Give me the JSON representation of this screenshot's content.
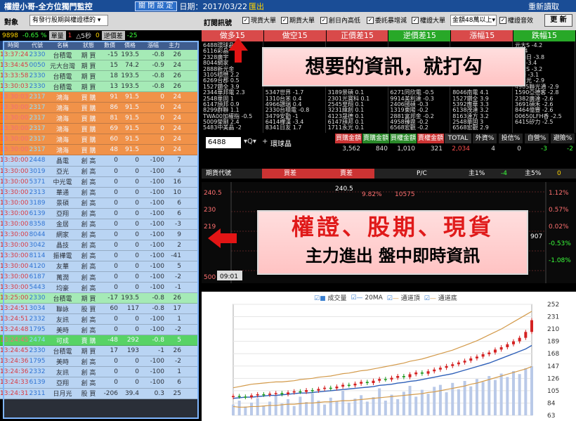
{
  "titlebar": {
    "title": "權證小哥-全方位獨門監控",
    "close_settings": "關 閉 設 定",
    "date_label": "日期：2017/03/22",
    "export": "匯出",
    "reload": "重新讀取"
  },
  "toolbar": {
    "target_label": "對象",
    "target_value": "有發行股期與權證標的",
    "subscribe_label": "訂閱訊號",
    "checkboxes": [
      "現貨大單",
      "期貨大單",
      "創日內高低",
      "委託暴增減",
      "權證大單",
      "權證音效"
    ],
    "amount_value": "金額48萬以上",
    "update": "更 新"
  },
  "stats": {
    "index": "9898",
    "pct": "-0.65 %",
    "mode": "單量",
    "qty": "1",
    "interval": "△5秒",
    "zero": "0",
    "inverse": "逆價差",
    "diff": "-25"
  },
  "columns": [
    "時間",
    "代號",
    "名稱",
    "狀態",
    "數價",
    "價格",
    "漲幅",
    "主力"
  ],
  "rows": [
    {
      "t": "13:37:24",
      "code": "2330",
      "name": "台積電",
      "st": "期 買",
      "q": "-15",
      "p": "193.5",
      "chg": "-0.8",
      "m": "26",
      "bg": "#9ef0a2"
    },
    {
      "t": "13:34:45",
      "code": "0050",
      "name": "元大台灣",
      "st": "期 買",
      "q": "15",
      "p": "74.2",
      "chg": "-0.9",
      "m": "24",
      "bg": "#9ef0a2"
    },
    {
      "t": "13:33:58",
      "code": "2330",
      "name": "台積電",
      "st": "期 買",
      "q": "18",
      "p": "193.5",
      "chg": "-0.8",
      "m": "26",
      "bg": "#9ef0a2"
    },
    {
      "t": "13:30:03",
      "code": "2330",
      "name": "台積電",
      "st": "期 買",
      "q": "13",
      "p": "193.5",
      "chg": "-0.8",
      "m": "26",
      "bg": "#9ef0a2"
    },
    {
      "t": "13:30:03",
      "code": "2317",
      "name": "鴻海",
      "st": "買 購",
      "q": "91",
      "p": "91.5",
      "chg": "0",
      "m": "24",
      "bg": "#ff7f17"
    },
    {
      "t": "13:30:00",
      "code": "2317",
      "name": "鴻海",
      "st": "買 購",
      "q": "86",
      "p": "91.5",
      "chg": "0",
      "m": "24",
      "bg": "#ff7f17"
    },
    {
      "t": "13:30:00",
      "code": "2317",
      "name": "鴻海",
      "st": "買 購",
      "q": "81",
      "p": "91.5",
      "chg": "0",
      "m": "24",
      "bg": "#ff7f17"
    },
    {
      "t": "13:30:00",
      "code": "2317",
      "name": "鴻海",
      "st": "買 購",
      "q": "69",
      "p": "91.5",
      "chg": "0",
      "m": "24",
      "bg": "#ff7f17"
    },
    {
      "t": "13:30:00",
      "code": "2317",
      "name": "鴻海",
      "st": "買 購",
      "q": "60",
      "p": "91.5",
      "chg": "0",
      "m": "24",
      "bg": "#ff7f17"
    },
    {
      "t": "13:30:00",
      "code": "2317",
      "name": "鴻海",
      "st": "買 購",
      "q": "48",
      "p": "91.5",
      "chg": "0",
      "m": "24",
      "bg": "#ff7f17"
    },
    {
      "t": "13:30:00",
      "code": "2448",
      "name": "晶電",
      "st": "創 高",
      "q": "0",
      "p": "0",
      "chg": "-100",
      "m": "7",
      "bg": "#b8d4f0"
    },
    {
      "t": "13:30:00",
      "code": "3019",
      "name": "亞光",
      "st": "創 高",
      "q": "0",
      "p": "0",
      "chg": "-100",
      "m": "4",
      "bg": "#b8d4f0"
    },
    {
      "t": "13:30:00",
      "code": "5371",
      "name": "中光電",
      "st": "創 高",
      "q": "0",
      "p": "0",
      "chg": "-100",
      "m": "16",
      "bg": "#b8d4f0"
    },
    {
      "t": "13:30:00",
      "code": "2313",
      "name": "華通",
      "st": "創 高",
      "q": "0",
      "p": "0",
      "chg": "-100",
      "m": "10",
      "bg": "#b8d4f0"
    },
    {
      "t": "13:30:00",
      "code": "3189",
      "name": "景碩",
      "st": "創 高",
      "q": "0",
      "p": "0",
      "chg": "-100",
      "m": "6",
      "bg": "#b8d4f0"
    },
    {
      "t": "13:30:00",
      "code": "6139",
      "name": "亞翔",
      "st": "創 高",
      "q": "0",
      "p": "0",
      "chg": "-100",
      "m": "6",
      "bg": "#b8d4f0"
    },
    {
      "t": "13:30:00",
      "code": "8358",
      "name": "金居",
      "st": "創 高",
      "q": "0",
      "p": "0",
      "chg": "-100",
      "m": "-3",
      "bg": "#b8d4f0"
    },
    {
      "t": "13:30:00",
      "code": "8044",
      "name": "網家",
      "st": "創 高",
      "q": "0",
      "p": "0",
      "chg": "-100",
      "m": "9",
      "bg": "#b8d4f0"
    },
    {
      "t": "13:30:00",
      "code": "3042",
      "name": "晶技",
      "st": "創 高",
      "q": "0",
      "p": "0",
      "chg": "-100",
      "m": "2",
      "bg": "#b8d4f0"
    },
    {
      "t": "13:30:00",
      "code": "8114",
      "name": "振樺電",
      "st": "創 高",
      "q": "0",
      "p": "0",
      "chg": "-100",
      "m": "-41",
      "bg": "#b8d4f0"
    },
    {
      "t": "13:30:00",
      "code": "4120",
      "name": "友華",
      "st": "創 高",
      "q": "0",
      "p": "0",
      "chg": "-100",
      "m": "5",
      "bg": "#b8d4f0"
    },
    {
      "t": "13:30:00",
      "code": "6187",
      "name": "萬潤",
      "st": "創 高",
      "q": "0",
      "p": "0",
      "chg": "-100",
      "m": "-2",
      "bg": "#b8d4f0"
    },
    {
      "t": "13:30:00",
      "code": "5443",
      "name": "均豪",
      "st": "創 高",
      "q": "0",
      "p": "0",
      "chg": "-100",
      "m": "-1",
      "bg": "#b8d4f0"
    },
    {
      "t": "13:25:00",
      "code": "2330",
      "name": "台積電",
      "st": "期 買",
      "q": "-17",
      "p": "193.5",
      "chg": "-0.8",
      "m": "26",
      "bg": "#9ef0a2"
    },
    {
      "t": "13:24:51",
      "code": "3034",
      "name": "聯詠",
      "st": "股 買",
      "q": "60",
      "p": "117",
      "chg": "-0.8",
      "m": "17",
      "bg": "#b8d4f0"
    },
    {
      "t": "13:24:51",
      "code": "2332",
      "name": "友訊",
      "st": "創 高",
      "q": "0",
      "p": "0",
      "chg": "-100",
      "m": "1",
      "bg": "#b8d4f0"
    },
    {
      "t": "13:24:48",
      "code": "1795",
      "name": "美時",
      "st": "創 高",
      "q": "0",
      "p": "0",
      "chg": "-100",
      "m": "-2",
      "bg": "#b8d4f0"
    },
    {
      "t": "13:24:45",
      "code": "2474",
      "name": "可成",
      "st": "賣 購",
      "q": "-48",
      "p": "292",
      "chg": "-0.8",
      "m": "5",
      "bg": "#3bd23b"
    },
    {
      "t": "13:24:45",
      "code": "2330",
      "name": "台積電",
      "st": "期 買",
      "q": "17",
      "p": "193",
      "chg": "-1",
      "m": "26",
      "bg": "#b8d4f0"
    },
    {
      "t": "13:24:36",
      "code": "1795",
      "name": "美時",
      "st": "創 高",
      "q": "0",
      "p": "0",
      "chg": "-100",
      "m": "-2",
      "bg": "#b8d4f0"
    },
    {
      "t": "13:24:36",
      "code": "2332",
      "name": "友訊",
      "st": "創 高",
      "q": "0",
      "p": "0",
      "chg": "-100",
      "m": "1",
      "bg": "#b8d4f0"
    },
    {
      "t": "13:24:33",
      "code": "6139",
      "name": "亞翔",
      "st": "創 高",
      "q": "0",
      "p": "0",
      "chg": "-100",
      "m": "6",
      "bg": "#b8d4f0"
    },
    {
      "t": "13:24:31",
      "code": "2311",
      "name": "日月光",
      "st": "股 買",
      "q": "-206",
      "p": "39.4",
      "chg": "0.3",
      "m": "25",
      "bg": "#b8d4f0"
    }
  ],
  "tabs": [
    {
      "label": "做多15",
      "bg": "#d94a4a"
    },
    {
      "label": "做空15",
      "bg": "#d94a4a"
    },
    {
      "label": "正價差15",
      "bg": "#d94a4a"
    },
    {
      "label": "逆價差15",
      "bg": "#28a828"
    },
    {
      "label": "漲幅15",
      "bg": "#d94a4a"
    },
    {
      "label": "跌幅15",
      "bg": "#28a828"
    }
  ],
  "quote_cols": [
    [
      "6488環球晶",
      "6116彩晶",
      "2328廣宇",
      "8044網家",
      "2888新光金",
      "3105穩懋 2.2",
      "6269台郡 0.5",
      "1527鑽全 3.9",
      "2344華邦電 2.3",
      "2548華固 1",
      "6147頎邦 0.9",
      "8299群聯 1.1",
      "TWA00加權指 -0.5",
      "5009榮剛 2.4",
      "5483中美晶 -2"
    ],
    [
      "",
      "",
      "",
      "",
      "",
      "",
      "",
      "",
      "5347世界 -1.7",
      "1310台苯 0.4",
      "4966譜瑞 0.4",
      "2330台積電 -0.8",
      "3479安勤 -1",
      "6414樺漢 -3.4",
      "8341日友 1.7"
    ],
    [
      "",
      "",
      "",
      "",
      "",
      "",
      "",
      "",
      "3189景碩 0.1",
      "2301光寶科 0.1",
      "2545皇翔 0.1",
      "3231緯創 0.1",
      "4123晟德 0.1",
      "6147頎邦 0.1",
      "1711永光 0.1"
    ],
    [
      "",
      "",
      "",
      "",
      "",
      "",
      "",
      "",
      "6271同欣電 -0.5",
      "9914美利達 -0.3",
      "2406國碩 -0.3",
      "1319東陽 -0.2",
      "2881富邦金 -0.2",
      "4958臻鼎 -0.2",
      "6568宏觀 -0.2"
    ],
    [
      "",
      "",
      "",
      "",
      "",
      "",
      "",
      "",
      "8046南電 4.1",
      "1527鑽全 3.9",
      "5392應華 3.3",
      "6138茂達 3.2",
      "8163達方 3.2",
      "2548華固 3",
      "6568宏觀 2.9"
    ],
    [
      "元大S -4.2",
      "購 -4",
      "國泰日 -3.8",
      "元S -3.4",
      "元大S -3.2",
      "志精 -3.1",
      "群日光 -2.9",
      "4905聯光通 -2.9",
      "1590亞德客 -2.8",
      "2382廣達 -2.6",
      "3691碩禾 -2.6",
      "8464億豐 -2.6",
      "00650LFH香 -2.5",
      "6415矽力 -2.5",
      ""
    ]
  ],
  "midbar": {
    "symbol": "6488",
    "search": "▾Q▾",
    "plus": "+",
    "name": "環球晶",
    "headers": [
      "買購金額",
      "賣購金額",
      "買權金額",
      "賣權金額",
      "TOTAL",
      "外資%",
      "投信%",
      "自營%",
      "避險%"
    ],
    "values": [
      "3,562",
      "840",
      "1,010",
      "321",
      "2,034",
      "4",
      "0",
      "-3",
      "-2"
    ]
  },
  "futures": {
    "label": "期貨代號",
    "buy": "買差",
    "sell": "賣差",
    "pc": "P/C",
    "main1": "主1%",
    "main5": "主5%",
    "n1": "-4",
    "n5": "0"
  },
  "minichart": {
    "left_ticks": [
      "240.5",
      "230",
      "219",
      "",
      "",
      "500"
    ],
    "top_price": "240.5",
    "top_pct": "9.82%",
    "top_num": "10575",
    "right_ticks": [
      "1.12%",
      "0.57%",
      "0.02%",
      "-0.53%",
      "-1.08%"
    ],
    "mid_num": "907",
    "time": "09:01"
  },
  "chart_data": {
    "type": "line",
    "legend": [
      "成交量",
      "20MA",
      "通道頂",
      "通道底"
    ],
    "yticks": [
      252,
      231,
      210,
      189,
      168,
      147,
      126,
      105,
      84,
      63
    ],
    "ylim": [
      63,
      252
    ],
    "close": [
      96,
      95,
      94,
      97,
      99,
      98,
      100,
      101,
      99,
      102,
      104,
      103,
      106,
      105,
      108,
      110,
      109,
      112,
      115,
      114,
      117,
      120,
      118,
      122,
      125,
      124,
      127,
      130,
      128,
      133,
      136,
      134,
      138,
      141,
      144,
      147,
      150,
      153,
      156,
      160,
      163,
      167,
      170,
      175,
      179,
      184,
      189,
      195,
      205,
      225
    ],
    "ma20": [
      92,
      93,
      94,
      94,
      95,
      96,
      97,
      97,
      98,
      99,
      100,
      101,
      101,
      102,
      103,
      104,
      105,
      106,
      107,
      108,
      109,
      110,
      111,
      112,
      114,
      115,
      116,
      118,
      119,
      121,
      122,
      124,
      126,
      128,
      130,
      132,
      134,
      137,
      140,
      143,
      146,
      149,
      152,
      156,
      160,
      164,
      168,
      172,
      176,
      182
    ],
    "upper": [
      110,
      112,
      114,
      116,
      117,
      118,
      119,
      120,
      120,
      121,
      122,
      124,
      125,
      126,
      128,
      129,
      130,
      132,
      134,
      135,
      137,
      139,
      140,
      142,
      144,
      146,
      148,
      150,
      152,
      155,
      157,
      159,
      162,
      165,
      168,
      171,
      174,
      178,
      182,
      186,
      190,
      195,
      200,
      205,
      210,
      216,
      222,
      228,
      234,
      240
    ],
    "lower": [
      78,
      77,
      77,
      78,
      78,
      79,
      80,
      80,
      81,
      82,
      82,
      83,
      84,
      84,
      85,
      86,
      86,
      87,
      88,
      88,
      89,
      90,
      91,
      92,
      93,
      94,
      95,
      96,
      97,
      98,
      99,
      100,
      102,
      103,
      105,
      107,
      109,
      111,
      113,
      116,
      118,
      121,
      124,
      127,
      130,
      133,
      136,
      139,
      142,
      146
    ],
    "volume": [
      22,
      30,
      18,
      26,
      35,
      20,
      28,
      40,
      24,
      33,
      19,
      38,
      27,
      45,
      30,
      22,
      36,
      29,
      50,
      26,
      34,
      41,
      28,
      37,
      55,
      30,
      42,
      33,
      48,
      60,
      38,
      52,
      44,
      58,
      62,
      47,
      66,
      53,
      70,
      59,
      74,
      68,
      80,
      72,
      85,
      78,
      90,
      84,
      96,
      100
    ]
  },
  "banners": {
    "b1": "想要的資訊，就打勾",
    "b2_l1": "權證、股期、現貨",
    "b2_l2": "主力進出 盤中即時資訊"
  }
}
